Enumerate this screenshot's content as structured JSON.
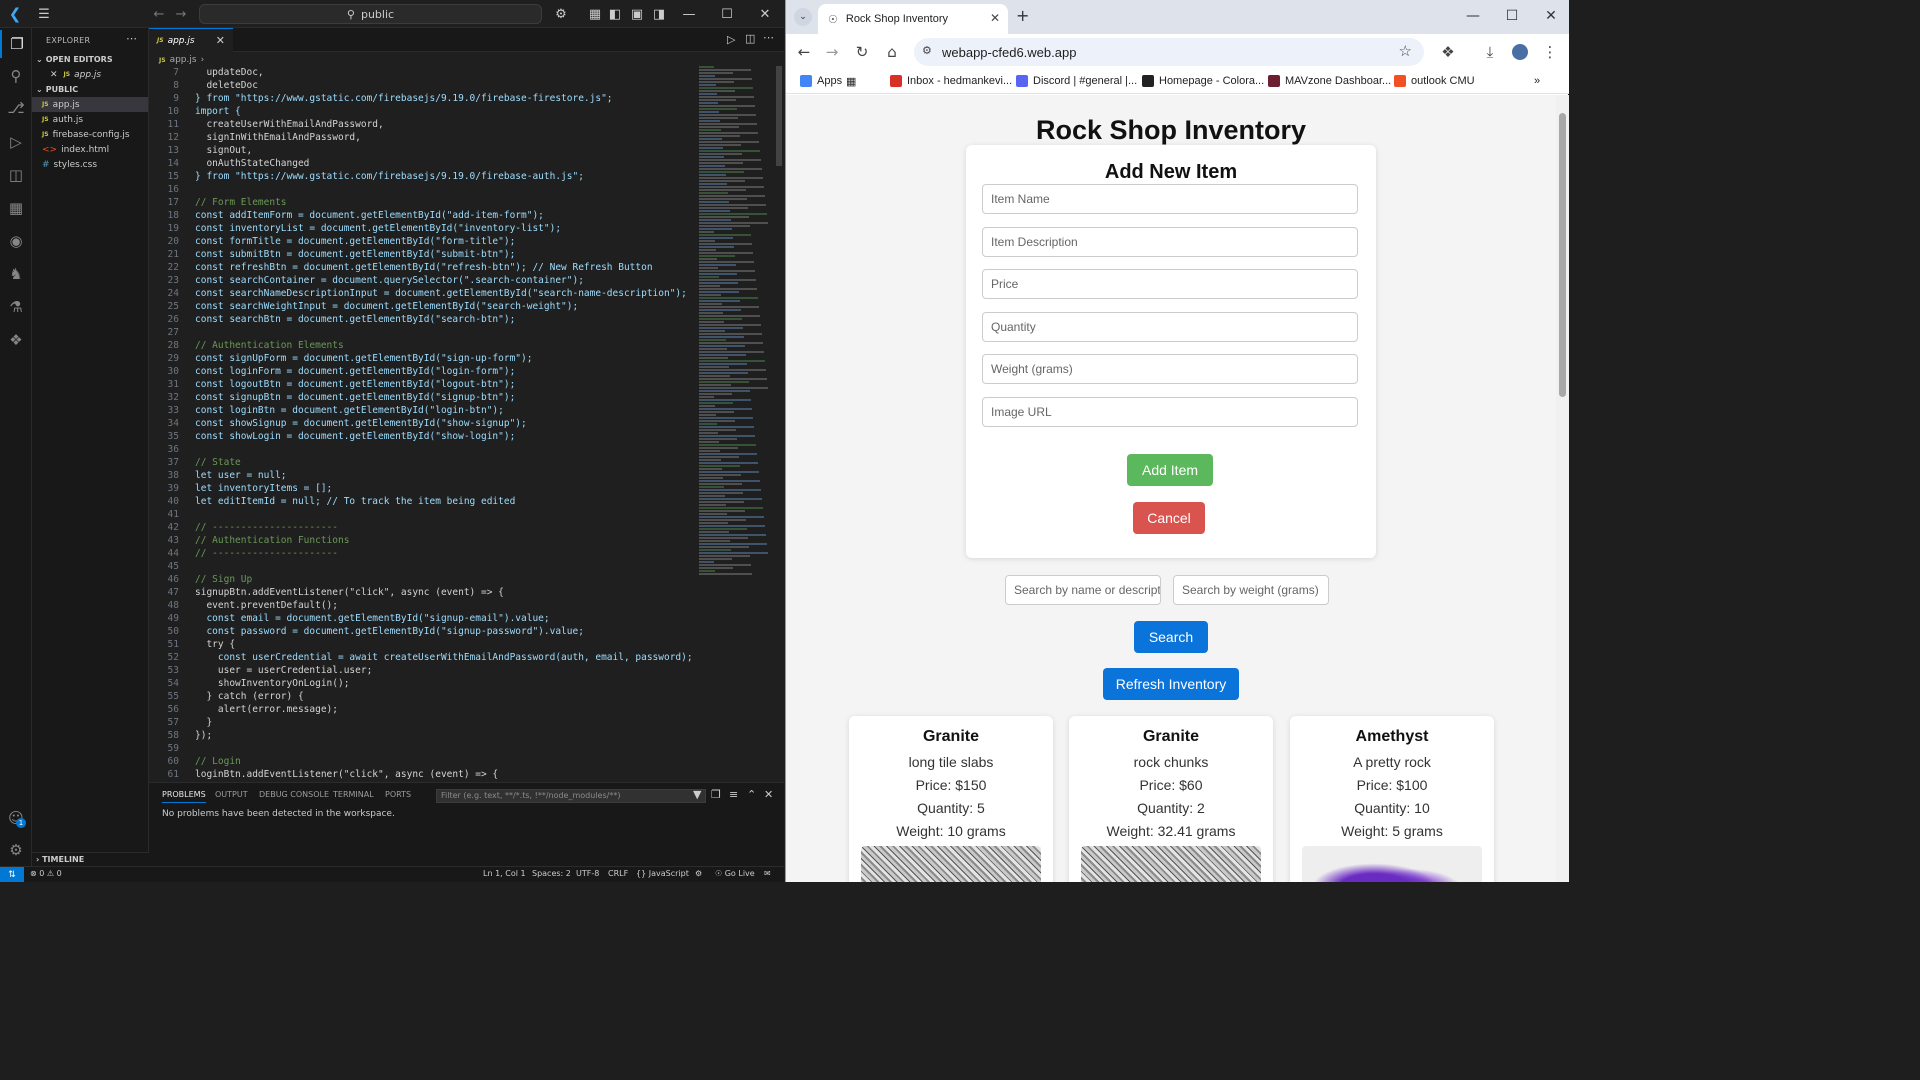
{
  "vscode": {
    "search_placeholder": "public",
    "sidebar": {
      "title": "EXPLORER",
      "open_editors_label": "OPEN EDITORS",
      "open_editor_file": "app.js",
      "folder_label": "PUBLIC",
      "files": [
        {
          "name": "app.js",
          "type": "js"
        },
        {
          "name": "auth.js",
          "type": "js"
        },
        {
          "name": "firebase-config.js",
          "type": "js"
        },
        {
          "name": "index.html",
          "type": "html"
        },
        {
          "name": "styles.css",
          "type": "css"
        }
      ],
      "timeline_label": "TIMELINE"
    },
    "tab_label": "app.js",
    "breadcrumb": "app.js",
    "code_lines": [
      {
        "n": "7",
        "t": "  updateDoc,"
      },
      {
        "n": "8",
        "t": "  deleteDoc"
      },
      {
        "n": "9",
        "t": "} from \"https://www.gstatic.com/firebasejs/9.19.0/firebase-firestore.js\";"
      },
      {
        "n": "10",
        "t": "import {"
      },
      {
        "n": "11",
        "t": "  createUserWithEmailAndPassword,"
      },
      {
        "n": "12",
        "t": "  signInWithEmailAndPassword,"
      },
      {
        "n": "13",
        "t": "  signOut,"
      },
      {
        "n": "14",
        "t": "  onAuthStateChanged"
      },
      {
        "n": "15",
        "t": "} from \"https://www.gstatic.com/firebasejs/9.19.0/firebase-auth.js\";"
      },
      {
        "n": "16",
        "t": ""
      },
      {
        "n": "17",
        "t": "// Form Elements"
      },
      {
        "n": "18",
        "t": "const addItemForm = document.getElementById(\"add-item-form\");"
      },
      {
        "n": "19",
        "t": "const inventoryList = document.getElementById(\"inventory-list\");"
      },
      {
        "n": "20",
        "t": "const formTitle = document.getElementById(\"form-title\");"
      },
      {
        "n": "21",
        "t": "const submitBtn = document.getElementById(\"submit-btn\");"
      },
      {
        "n": "22",
        "t": "const refreshBtn = document.getElementById(\"refresh-btn\"); // New Refresh Button"
      },
      {
        "n": "23",
        "t": "const searchContainer = document.querySelector(\".search-container\");"
      },
      {
        "n": "24",
        "t": "const searchNameDescriptionInput = document.getElementById(\"search-name-description\");"
      },
      {
        "n": "25",
        "t": "const searchWeightInput = document.getElementById(\"search-weight\");"
      },
      {
        "n": "26",
        "t": "const searchBtn = document.getElementById(\"search-btn\");"
      },
      {
        "n": "27",
        "t": ""
      },
      {
        "n": "28",
        "t": "// Authentication Elements"
      },
      {
        "n": "29",
        "t": "const signUpForm = document.getElementById(\"sign-up-form\");"
      },
      {
        "n": "30",
        "t": "const loginForm = document.getElementById(\"login-form\");"
      },
      {
        "n": "31",
        "t": "const logoutBtn = document.getElementById(\"logout-btn\");"
      },
      {
        "n": "32",
        "t": "const signupBtn = document.getElementById(\"signup-btn\");"
      },
      {
        "n": "33",
        "t": "const loginBtn = document.getElementById(\"login-btn\");"
      },
      {
        "n": "34",
        "t": "const showSignup = document.getElementById(\"show-signup\");"
      },
      {
        "n": "35",
        "t": "const showLogin = document.getElementById(\"show-login\");"
      },
      {
        "n": "36",
        "t": ""
      },
      {
        "n": "37",
        "t": "// State"
      },
      {
        "n": "38",
        "t": "let user = null;"
      },
      {
        "n": "39",
        "t": "let inventoryItems = [];"
      },
      {
        "n": "40",
        "t": "let editItemId = null; // To track the item being edited"
      },
      {
        "n": "41",
        "t": ""
      },
      {
        "n": "42",
        "t": "// ----------------------"
      },
      {
        "n": "43",
        "t": "// Authentication Functions"
      },
      {
        "n": "44",
        "t": "// ----------------------"
      },
      {
        "n": "45",
        "t": ""
      },
      {
        "n": "46",
        "t": "// Sign Up"
      },
      {
        "n": "47",
        "t": "signupBtn.addEventListener(\"click\", async (event) => {"
      },
      {
        "n": "48",
        "t": "  event.preventDefault();"
      },
      {
        "n": "49",
        "t": "  const email = document.getElementById(\"signup-email\").value;"
      },
      {
        "n": "50",
        "t": "  const password = document.getElementById(\"signup-password\").value;"
      },
      {
        "n": "51",
        "t": "  try {"
      },
      {
        "n": "52",
        "t": "    const userCredential = await createUserWithEmailAndPassword(auth, email, password);"
      },
      {
        "n": "53",
        "t": "    user = userCredential.user;"
      },
      {
        "n": "54",
        "t": "    showInventoryOnLogin();"
      },
      {
        "n": "55",
        "t": "  } catch (error) {"
      },
      {
        "n": "56",
        "t": "    alert(error.message);"
      },
      {
        "n": "57",
        "t": "  }"
      },
      {
        "n": "58",
        "t": "});"
      },
      {
        "n": "59",
        "t": ""
      },
      {
        "n": "60",
        "t": "// Login"
      },
      {
        "n": "61",
        "t": "loginBtn.addEventListener(\"click\", async (event) => {"
      }
    ],
    "panel": {
      "tabs": [
        "PROBLEMS",
        "OUTPUT",
        "DEBUG CONSOLE",
        "TERMINAL",
        "PORTS"
      ],
      "filter_placeholder": "Filter (e.g. text, **/*.ts, !**/node_modules/**)",
      "message": "No problems have been detected in the workspace."
    },
    "status": {
      "problems": "0",
      "warnings": "0",
      "position": "Ln 1, Col 1",
      "spaces": "Spaces: 2",
      "encoding": "UTF-8",
      "eol": "CRLF",
      "language": "JavaScript",
      "golive": "Go Live"
    },
    "accounts_badge": "1"
  },
  "chrome": {
    "tab_title": "Rock Shop Inventory",
    "url": "webapp-cfed6.web.app",
    "bookmarks": [
      {
        "label": "Apps",
        "color": "#4285f4"
      },
      {
        "label": "Inbox - hedmankevi...",
        "color": "#d93025"
      },
      {
        "label": "Discord | #general |...",
        "color": "#5865f2"
      },
      {
        "label": "Homepage - Colora...",
        "color": "#222222"
      },
      {
        "label": "MAVzone Dashboar...",
        "color": "#6d1f2f"
      },
      {
        "label": "outlook CMU",
        "color": "#f25022"
      }
    ],
    "page": {
      "title": "Rock Shop Inventory",
      "form_title": "Add New Item",
      "fields": [
        "Item Name",
        "Item Description",
        "Price",
        "Quantity",
        "Weight (grams)",
        "Image URL"
      ],
      "add_label": "Add Item",
      "cancel_label": "Cancel",
      "search_name_placeholder": "Search by name or description",
      "search_weight_placeholder": "Search by weight (grams)",
      "search_label": "Search",
      "refresh_label": "Refresh Inventory",
      "items": [
        {
          "name": "Granite",
          "description": "long tile slabs",
          "price": "Price: $150",
          "quantity": "Quantity: 5",
          "weight": "Weight: 10 grams"
        },
        {
          "name": "Granite",
          "description": "rock chunks",
          "price": "Price: $60",
          "quantity": "Quantity: 2",
          "weight": "Weight: 32.41 grams"
        },
        {
          "name": "Amethyst",
          "description": "A pretty rock",
          "price": "Price: $100",
          "quantity": "Quantity: 10",
          "weight": "Weight: 5 grams"
        }
      ]
    },
    "colors": {
      "add_button": "#5cb85c",
      "cancel_button": "#d9534f",
      "primary_button": "#0a74da"
    }
  }
}
